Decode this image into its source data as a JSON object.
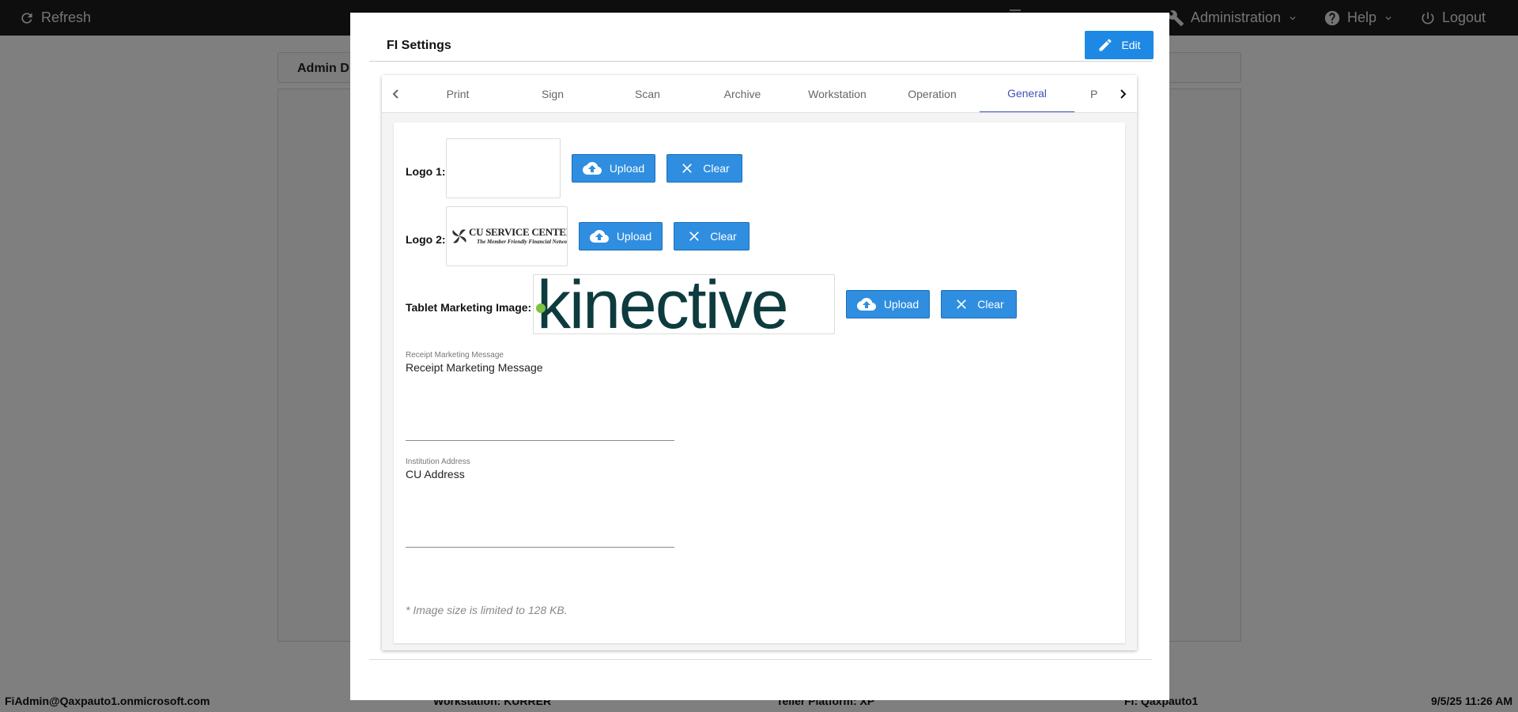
{
  "app": {
    "refresh_label": "Refresh",
    "administration_label": "Administration",
    "help_label": "Help",
    "logout_label": "Logout",
    "panel_title": "Admin D"
  },
  "status_bar": {
    "user": "FiAdmin@Qaxpauto1.onmicrosoft.com",
    "workstation": "Workstation: KURRER",
    "teller_platform": "Teller Platform: XP",
    "fi": "FI: Qaxpauto1",
    "datetime": "9/5/25 11:26 AM"
  },
  "modal": {
    "title": "FI Settings",
    "edit_label": "Edit",
    "tabs": [
      {
        "label": "Print",
        "active": false
      },
      {
        "label": "Sign",
        "active": false
      },
      {
        "label": "Scan",
        "active": false
      },
      {
        "label": "Archive",
        "active": false
      },
      {
        "label": "Workstation",
        "active": false
      },
      {
        "label": "Operation",
        "active": false
      },
      {
        "label": "General",
        "active": true
      },
      {
        "label": "P",
        "active": false
      }
    ],
    "general": {
      "logo1": {
        "label": "Logo 1:",
        "upload_label": "Upload",
        "clear_label": "Clear"
      },
      "logo2": {
        "label": "Logo 2:",
        "upload_label": "Upload",
        "clear_label": "Clear",
        "image_text": "CU SERVICE CENTERS®",
        "image_tagline": "The Member Friendly Financial Network"
      },
      "tablet": {
        "label": "Tablet Marketing Image:",
        "upload_label": "Upload",
        "clear_label": "Clear",
        "image_text": "kinective"
      },
      "receipt_message": {
        "label": "Receipt Marketing Message",
        "value": "Receipt Marketing Message"
      },
      "institution_address": {
        "label": "Institution Address",
        "value": "CU Address"
      },
      "note": "* Image size is limited to 128 KB."
    }
  },
  "colors": {
    "primary_button": "#2f8ee0",
    "active_tab": "#3f51b5",
    "kinective_text": "#0d3b3e",
    "kinective_dot": "#7dc242"
  }
}
